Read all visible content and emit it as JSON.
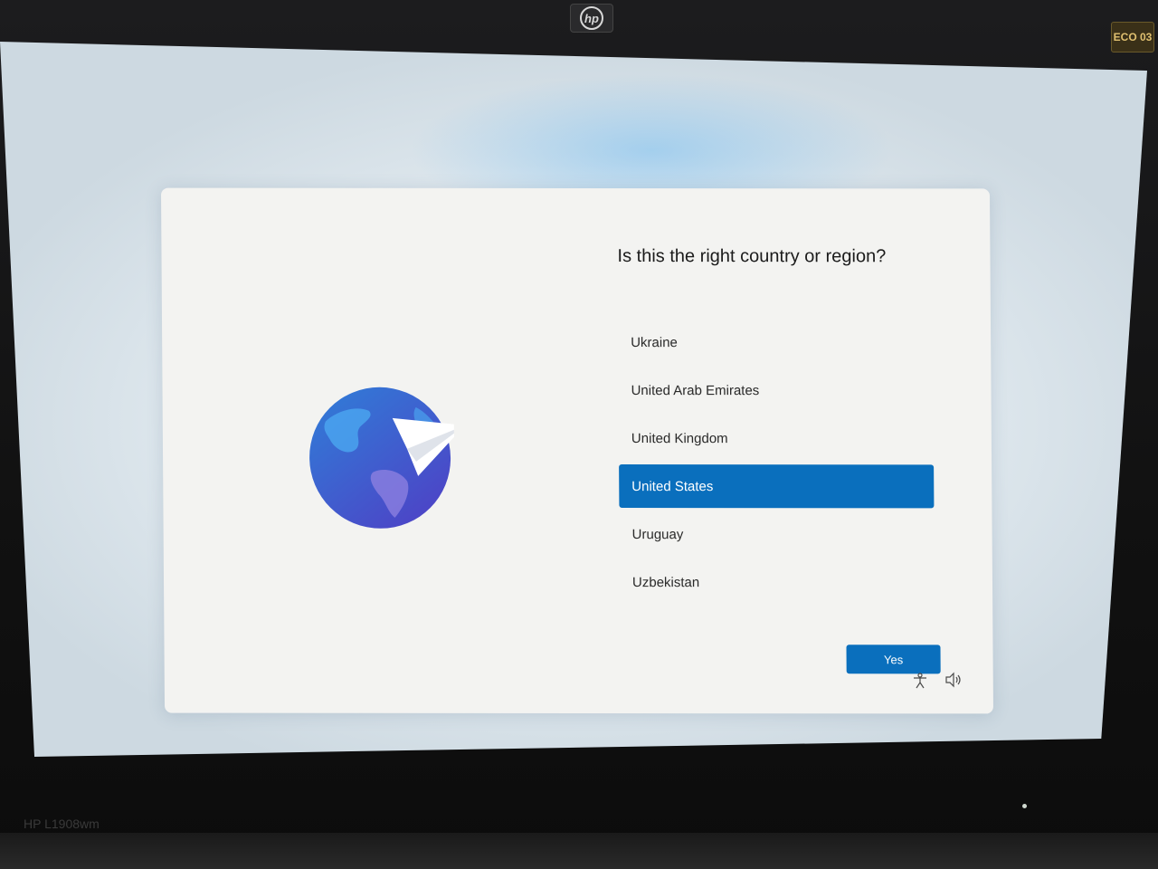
{
  "monitor": {
    "brand_logo": "hp",
    "sticker": "ECO 03",
    "model_label": "HP L1908wm"
  },
  "setup": {
    "question": "Is this the right country or region?",
    "countries": [
      "Ukraine",
      "United Arab Emirates",
      "United Kingdom",
      "United States",
      "Uruguay",
      "Uzbekistan"
    ],
    "selected_country": "United States",
    "confirm_label": "Yes"
  },
  "tray": {
    "icons": [
      "accessibility-icon",
      "volume-icon"
    ]
  },
  "colors": {
    "accent": "#0a6fbd",
    "card": "#f3f3f1",
    "globe_light": "#3b8be0",
    "globe_dark": "#4b45c8"
  }
}
